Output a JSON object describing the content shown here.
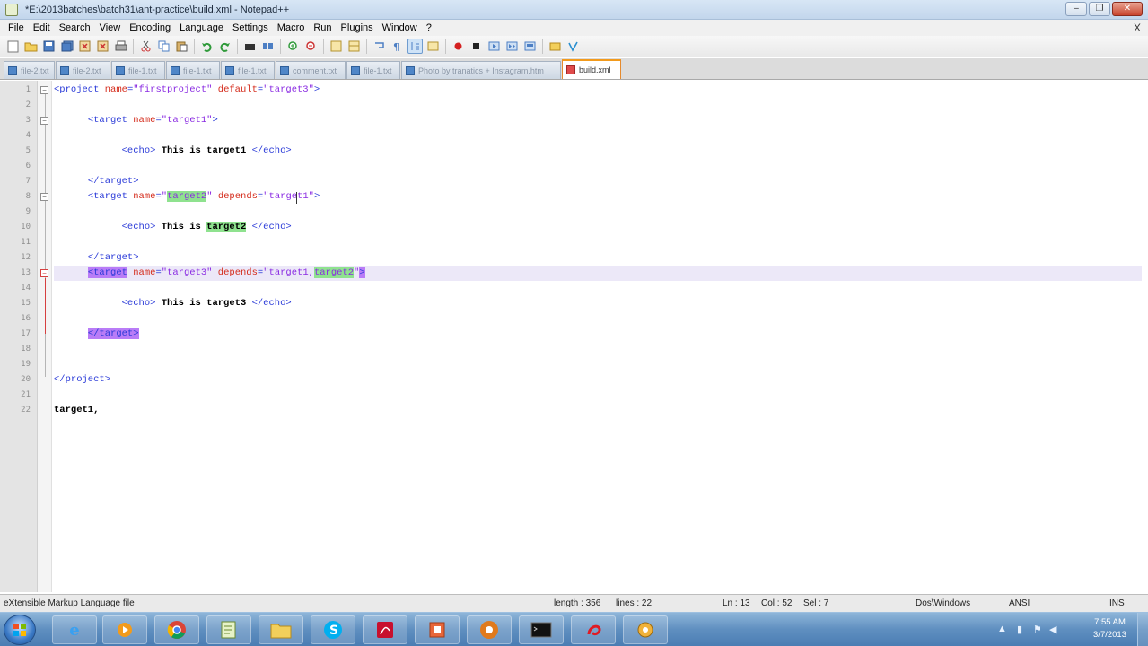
{
  "window": {
    "title": "*E:\\2013batches\\batch31\\ant-practice\\build.xml - Notepad++",
    "controls": [
      "–",
      "❐",
      "✕"
    ]
  },
  "menu": {
    "items": [
      "File",
      "Edit",
      "Search",
      "View",
      "Encoding",
      "Language",
      "Settings",
      "Macro",
      "Run",
      "Plugins",
      "Window",
      "?"
    ],
    "close_glyph": "X"
  },
  "toolbar": {
    "icons": [
      "new-file-icon",
      "open-file-icon",
      "save-icon",
      "save-all-icon",
      "close-icon",
      "close-all-icon",
      "print-icon",
      "cut-icon",
      "copy-icon",
      "paste-icon",
      "undo-icon",
      "redo-icon",
      "find-icon",
      "replace-icon",
      "zoom-in-icon",
      "zoom-out-icon",
      "sync-v-icon",
      "sync-h-icon",
      "wrap-icon",
      "all-chars-icon",
      "indent-guide-icon",
      "lang-icon",
      "record-macro-icon",
      "stop-macro-icon",
      "play-macro-icon",
      "play-multi-icon",
      "save-macro-icon",
      "trim-icon",
      "spell-icon",
      "launch-icon"
    ]
  },
  "tabs": [
    {
      "label": "file-2.txt",
      "active": false
    },
    {
      "label": "file-2.txt",
      "active": false
    },
    {
      "label": "file-1.txt",
      "active": false
    },
    {
      "label": "file-1.txt",
      "active": false
    },
    {
      "label": "file-1.txt",
      "active": false
    },
    {
      "label": "comment.txt",
      "active": false
    },
    {
      "label": "file-1.txt",
      "active": false
    },
    {
      "label": "Photo by tranatics + Instagram.htm",
      "active": false
    },
    {
      "label": "build.xml",
      "active": true
    }
  ],
  "editor": {
    "line_numbers": [
      "1",
      "2",
      "3",
      "4",
      "5",
      "6",
      "7",
      "8",
      "9",
      "10",
      "11",
      "12",
      "13",
      "14",
      "15",
      "16",
      "17",
      "18",
      "19",
      "20",
      "21",
      "22"
    ],
    "current_line": "13"
  },
  "status": {
    "file_type": "eXtensible Markup Language file",
    "length": "length : 356",
    "lines": "lines : 22",
    "ln": "Ln : 13",
    "col": "Col : 52",
    "sel": "Sel : 7",
    "eol": "Dos\\Windows",
    "encoding": "ANSI",
    "mode": "INS"
  },
  "taskbar": {
    "apps": [
      "ie-icon",
      "media-player-icon",
      "chrome-icon",
      "notepad-plus-icon",
      "folder-icon",
      "skype-icon",
      "pdf-icon",
      "office-icon",
      "chrome-alt-icon",
      "cmd-icon",
      "airtel-icon",
      "settings-icon"
    ],
    "time": "7:55 AM",
    "date": "3/7/2013"
  }
}
